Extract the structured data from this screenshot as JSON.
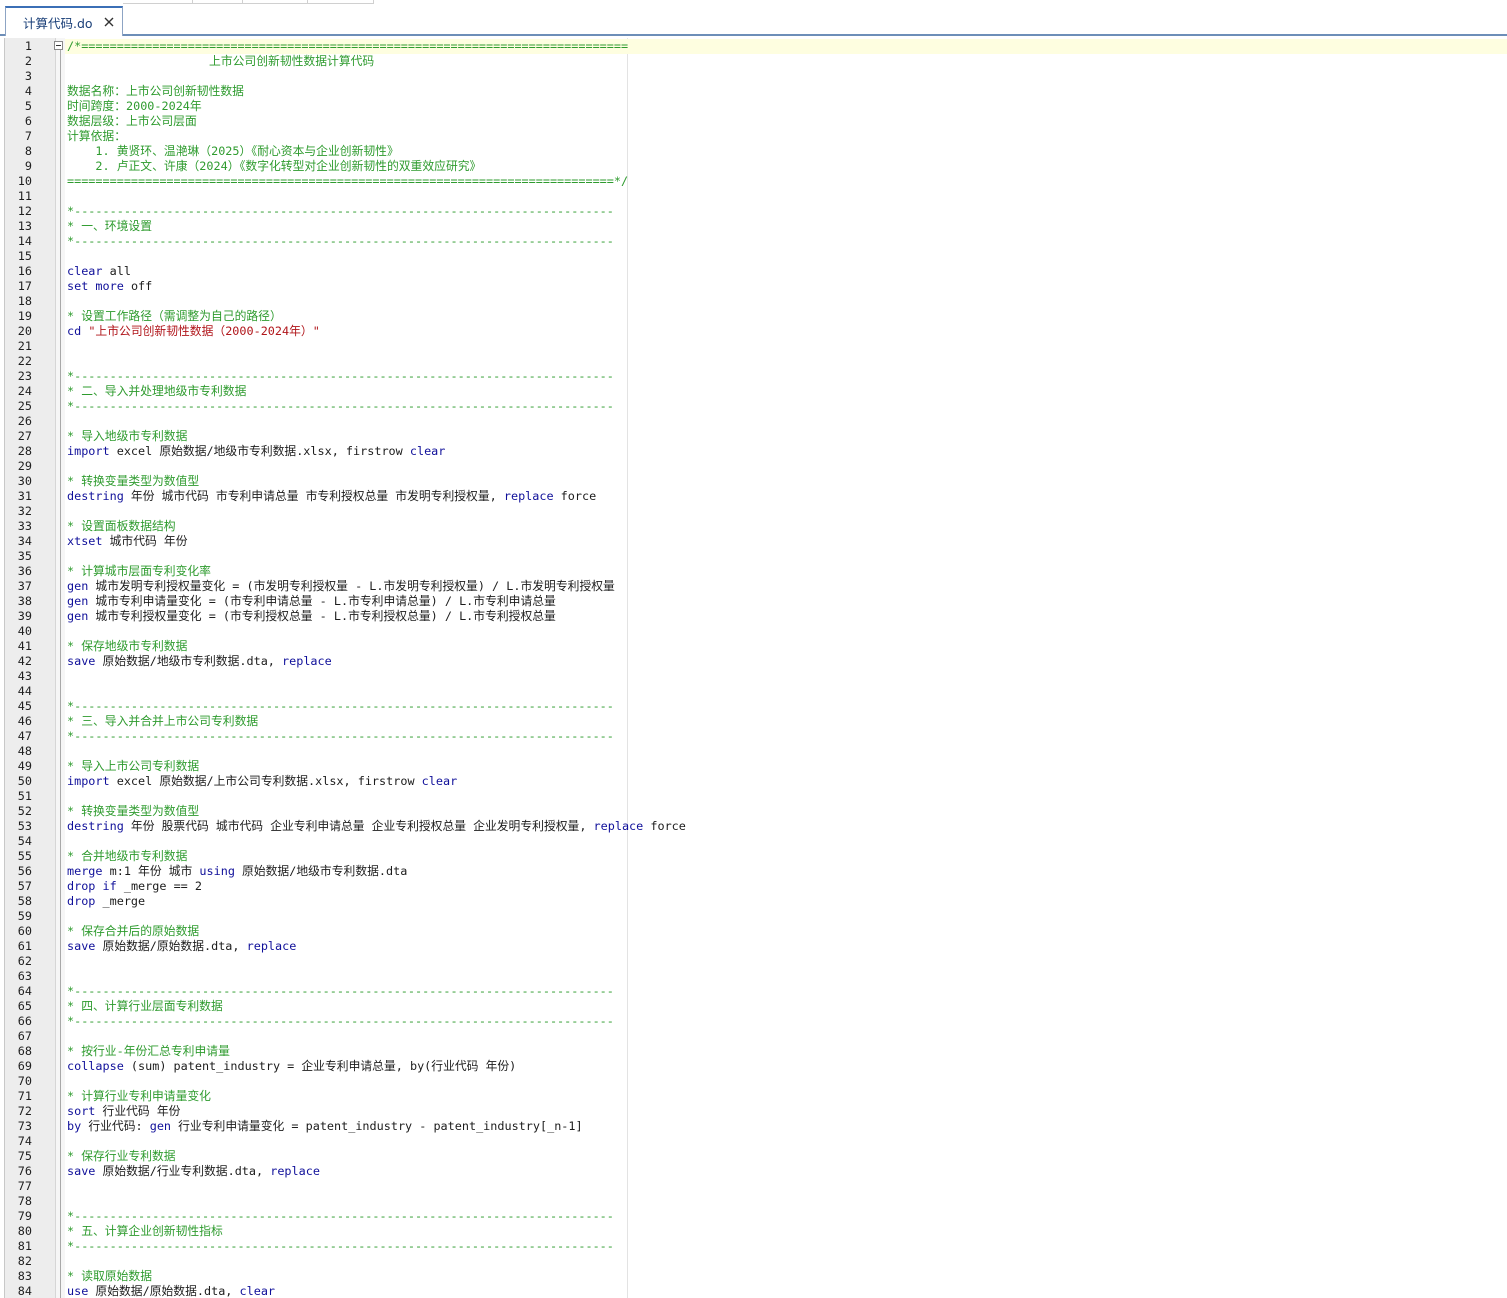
{
  "tabs": [
    {
      "title": "计算代码.do",
      "close_label": "×"
    }
  ],
  "editor": {
    "lines": [
      {
        "n": "1",
        "tokens": [
          {
            "t": "/*=============================================================================",
            "c": "comment"
          }
        ]
      },
      {
        "n": "2",
        "tokens": [
          {
            "t": "                    上市公司创新韧性数据计算代码",
            "c": "comment"
          }
        ]
      },
      {
        "n": "3",
        "tokens": []
      },
      {
        "n": "4",
        "tokens": [
          {
            "t": "数据名称：上市公司创新韧性数据",
            "c": "comment"
          }
        ]
      },
      {
        "n": "5",
        "tokens": [
          {
            "t": "时间跨度：2000-2024年",
            "c": "comment"
          }
        ]
      },
      {
        "n": "6",
        "tokens": [
          {
            "t": "数据层级：上市公司层面",
            "c": "comment"
          }
        ]
      },
      {
        "n": "7",
        "tokens": [
          {
            "t": "计算依据：",
            "c": "comment"
          }
        ]
      },
      {
        "n": "8",
        "tokens": [
          {
            "t": "    1. 黄贤环、温滟琳（2025）《耐心资本与企业创新韧性》",
            "c": "comment"
          }
        ]
      },
      {
        "n": "9",
        "tokens": [
          {
            "t": "    2. 卢正文、许康（2024）《数字化转型对企业创新韧性的双重效应研究》",
            "c": "comment"
          }
        ]
      },
      {
        "n": "10",
        "tokens": [
          {
            "t": "=============================================================================*/",
            "c": "comment"
          }
        ]
      },
      {
        "n": "11",
        "tokens": []
      },
      {
        "n": "12",
        "tokens": [
          {
            "t": "*----------------------------------------------------------------------------",
            "c": "comment"
          }
        ]
      },
      {
        "n": "13",
        "tokens": [
          {
            "t": "* 一、环境设置",
            "c": "comment"
          }
        ]
      },
      {
        "n": "14",
        "tokens": [
          {
            "t": "*----------------------------------------------------------------------------",
            "c": "comment"
          }
        ]
      },
      {
        "n": "15",
        "tokens": []
      },
      {
        "n": "16",
        "tokens": [
          {
            "t": "clear",
            "c": "kw"
          },
          {
            "t": " all",
            "c": "plain"
          }
        ]
      },
      {
        "n": "17",
        "tokens": [
          {
            "t": "set",
            "c": "kw"
          },
          {
            "t": " ",
            "c": "plain"
          },
          {
            "t": "more",
            "c": "kw"
          },
          {
            "t": " off",
            "c": "plain"
          }
        ]
      },
      {
        "n": "18",
        "tokens": []
      },
      {
        "n": "19",
        "tokens": [
          {
            "t": "* 设置工作路径（需调整为自己的路径）",
            "c": "comment"
          }
        ]
      },
      {
        "n": "20",
        "tokens": [
          {
            "t": "cd",
            "c": "kw"
          },
          {
            "t": " ",
            "c": "plain"
          },
          {
            "t": "\"上市公司创新韧性数据（2000-2024年）\"",
            "c": "string"
          }
        ]
      },
      {
        "n": "21",
        "tokens": []
      },
      {
        "n": "22",
        "tokens": []
      },
      {
        "n": "23",
        "tokens": [
          {
            "t": "*----------------------------------------------------------------------------",
            "c": "comment"
          }
        ]
      },
      {
        "n": "24",
        "tokens": [
          {
            "t": "* 二、导入并处理地级市专利数据",
            "c": "comment"
          }
        ]
      },
      {
        "n": "25",
        "tokens": [
          {
            "t": "*----------------------------------------------------------------------------",
            "c": "comment"
          }
        ]
      },
      {
        "n": "26",
        "tokens": []
      },
      {
        "n": "27",
        "tokens": [
          {
            "t": "* 导入地级市专利数据",
            "c": "comment"
          }
        ]
      },
      {
        "n": "28",
        "tokens": [
          {
            "t": "import",
            "c": "kw"
          },
          {
            "t": " excel 原始数据/地级市专利数据.xlsx, firstrow ",
            "c": "plain"
          },
          {
            "t": "clear",
            "c": "kw"
          }
        ]
      },
      {
        "n": "29",
        "tokens": []
      },
      {
        "n": "30",
        "tokens": [
          {
            "t": "* 转换变量类型为数值型",
            "c": "comment"
          }
        ]
      },
      {
        "n": "31",
        "tokens": [
          {
            "t": "destring",
            "c": "kw"
          },
          {
            "t": " 年份 城市代码 市专利申请总量 市专利授权总量 市发明专利授权量, ",
            "c": "plain"
          },
          {
            "t": "replace",
            "c": "kw"
          },
          {
            "t": " force",
            "c": "plain"
          }
        ]
      },
      {
        "n": "32",
        "tokens": []
      },
      {
        "n": "33",
        "tokens": [
          {
            "t": "* 设置面板数据结构",
            "c": "comment"
          }
        ]
      },
      {
        "n": "34",
        "tokens": [
          {
            "t": "xtset",
            "c": "kw"
          },
          {
            "t": " 城市代码 年份",
            "c": "plain"
          }
        ]
      },
      {
        "n": "35",
        "tokens": []
      },
      {
        "n": "36",
        "tokens": [
          {
            "t": "* 计算城市层面专利变化率",
            "c": "comment"
          }
        ]
      },
      {
        "n": "37",
        "tokens": [
          {
            "t": "gen",
            "c": "kw"
          },
          {
            "t": " 城市发明专利授权量变化 = (市发明专利授权量 - L.市发明专利授权量) / L.市发明专利授权量",
            "c": "plain"
          }
        ]
      },
      {
        "n": "38",
        "tokens": [
          {
            "t": "gen",
            "c": "kw"
          },
          {
            "t": " 城市专利申请量变化 = (市专利申请总量 - L.市专利申请总量) / L.市专利申请总量",
            "c": "plain"
          }
        ]
      },
      {
        "n": "39",
        "tokens": [
          {
            "t": "gen",
            "c": "kw"
          },
          {
            "t": " 城市专利授权量变化 = (市专利授权总量 - L.市专利授权总量) / L.市专利授权总量",
            "c": "plain"
          }
        ]
      },
      {
        "n": "40",
        "tokens": []
      },
      {
        "n": "41",
        "tokens": [
          {
            "t": "* 保存地级市专利数据",
            "c": "comment"
          }
        ]
      },
      {
        "n": "42",
        "tokens": [
          {
            "t": "save",
            "c": "kw"
          },
          {
            "t": " 原始数据/地级市专利数据.dta, ",
            "c": "plain"
          },
          {
            "t": "replace",
            "c": "kw"
          }
        ]
      },
      {
        "n": "43",
        "tokens": []
      },
      {
        "n": "44",
        "tokens": []
      },
      {
        "n": "45",
        "tokens": [
          {
            "t": "*----------------------------------------------------------------------------",
            "c": "comment"
          }
        ]
      },
      {
        "n": "46",
        "tokens": [
          {
            "t": "* 三、导入并合并上市公司专利数据",
            "c": "comment"
          }
        ]
      },
      {
        "n": "47",
        "tokens": [
          {
            "t": "*----------------------------------------------------------------------------",
            "c": "comment"
          }
        ]
      },
      {
        "n": "48",
        "tokens": []
      },
      {
        "n": "49",
        "tokens": [
          {
            "t": "* 导入上市公司专利数据",
            "c": "comment"
          }
        ]
      },
      {
        "n": "50",
        "tokens": [
          {
            "t": "import",
            "c": "kw"
          },
          {
            "t": " excel 原始数据/上市公司专利数据.xlsx, firstrow ",
            "c": "plain"
          },
          {
            "t": "clear",
            "c": "kw"
          }
        ]
      },
      {
        "n": "51",
        "tokens": []
      },
      {
        "n": "52",
        "tokens": [
          {
            "t": "* 转换变量类型为数值型",
            "c": "comment"
          }
        ]
      },
      {
        "n": "53",
        "tokens": [
          {
            "t": "destring",
            "c": "kw"
          },
          {
            "t": " 年份 股票代码 城市代码 企业专利申请总量 企业专利授权总量 企业发明专利授权量, ",
            "c": "plain"
          },
          {
            "t": "replace",
            "c": "kw"
          },
          {
            "t": " force",
            "c": "plain"
          }
        ]
      },
      {
        "n": "54",
        "tokens": []
      },
      {
        "n": "55",
        "tokens": [
          {
            "t": "* 合并地级市专利数据",
            "c": "comment"
          }
        ]
      },
      {
        "n": "56",
        "tokens": [
          {
            "t": "merge",
            "c": "kw"
          },
          {
            "t": " m:1 年份 城市 ",
            "c": "plain"
          },
          {
            "t": "using",
            "c": "kw"
          },
          {
            "t": " 原始数据/地级市专利数据.dta",
            "c": "plain"
          }
        ]
      },
      {
        "n": "57",
        "tokens": [
          {
            "t": "drop",
            "c": "kw"
          },
          {
            "t": " ",
            "c": "plain"
          },
          {
            "t": "if",
            "c": "kw"
          },
          {
            "t": " _merge == 2",
            "c": "plain"
          }
        ]
      },
      {
        "n": "58",
        "tokens": [
          {
            "t": "drop",
            "c": "kw"
          },
          {
            "t": " _merge",
            "c": "plain"
          }
        ]
      },
      {
        "n": "59",
        "tokens": []
      },
      {
        "n": "60",
        "tokens": [
          {
            "t": "* 保存合并后的原始数据",
            "c": "comment"
          }
        ]
      },
      {
        "n": "61",
        "tokens": [
          {
            "t": "save",
            "c": "kw"
          },
          {
            "t": " 原始数据/原始数据.dta, ",
            "c": "plain"
          },
          {
            "t": "replace",
            "c": "kw"
          }
        ]
      },
      {
        "n": "62",
        "tokens": []
      },
      {
        "n": "63",
        "tokens": []
      },
      {
        "n": "64",
        "tokens": [
          {
            "t": "*----------------------------------------------------------------------------",
            "c": "comment"
          }
        ]
      },
      {
        "n": "65",
        "tokens": [
          {
            "t": "* 四、计算行业层面专利数据",
            "c": "comment"
          }
        ]
      },
      {
        "n": "66",
        "tokens": [
          {
            "t": "*----------------------------------------------------------------------------",
            "c": "comment"
          }
        ]
      },
      {
        "n": "67",
        "tokens": []
      },
      {
        "n": "68",
        "tokens": [
          {
            "t": "* 按行业-年份汇总专利申请量",
            "c": "comment"
          }
        ]
      },
      {
        "n": "69",
        "tokens": [
          {
            "t": "collapse",
            "c": "kw"
          },
          {
            "t": " (sum) patent_industry = 企业专利申请总量, by(行业代码 年份)",
            "c": "plain"
          }
        ]
      },
      {
        "n": "70",
        "tokens": []
      },
      {
        "n": "71",
        "tokens": [
          {
            "t": "* 计算行业专利申请量变化",
            "c": "comment"
          }
        ]
      },
      {
        "n": "72",
        "tokens": [
          {
            "t": "sort",
            "c": "kw"
          },
          {
            "t": " 行业代码 年份",
            "c": "plain"
          }
        ]
      },
      {
        "n": "73",
        "tokens": [
          {
            "t": "by",
            "c": "kw"
          },
          {
            "t": " 行业代码: ",
            "c": "plain"
          },
          {
            "t": "gen",
            "c": "kw"
          },
          {
            "t": " 行业专利申请量变化 = patent_industry - patent_industry[_n-1]",
            "c": "plain"
          }
        ]
      },
      {
        "n": "74",
        "tokens": []
      },
      {
        "n": "75",
        "tokens": [
          {
            "t": "* 保存行业专利数据",
            "c": "comment"
          }
        ]
      },
      {
        "n": "76",
        "tokens": [
          {
            "t": "save",
            "c": "kw"
          },
          {
            "t": " 原始数据/行业专利数据.dta, ",
            "c": "plain"
          },
          {
            "t": "replace",
            "c": "kw"
          }
        ]
      },
      {
        "n": "77",
        "tokens": []
      },
      {
        "n": "78",
        "tokens": []
      },
      {
        "n": "79",
        "tokens": [
          {
            "t": "*----------------------------------------------------------------------------",
            "c": "comment"
          }
        ]
      },
      {
        "n": "80",
        "tokens": [
          {
            "t": "* 五、计算企业创新韧性指标",
            "c": "comment"
          }
        ]
      },
      {
        "n": "81",
        "tokens": [
          {
            "t": "*----------------------------------------------------------------------------",
            "c": "comment"
          }
        ]
      },
      {
        "n": "82",
        "tokens": []
      },
      {
        "n": "83",
        "tokens": [
          {
            "t": "* 读取原始数据",
            "c": "comment"
          }
        ]
      },
      {
        "n": "84",
        "tokens": [
          {
            "t": "use",
            "c": "kw"
          },
          {
            "t": " 原始数据/原始数据.dta, ",
            "c": "plain"
          },
          {
            "t": "clear",
            "c": "kw"
          }
        ]
      }
    ]
  },
  "colors": {
    "comment": "#2e9b2e",
    "keyword": "#10109a",
    "plain": "#1c1c1c",
    "string": "#b0151a",
    "tab_text": "#1a3f78",
    "current_line": "#fefee0"
  },
  "icons": {
    "tab_close": "close-icon",
    "fold": "fold-minus-icon"
  }
}
